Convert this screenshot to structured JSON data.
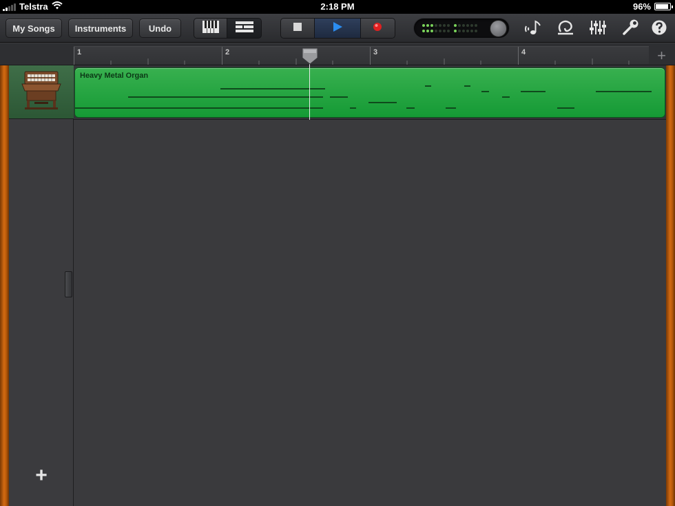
{
  "status_bar": {
    "carrier": "Telstra",
    "time": "2:18 PM",
    "battery": "96%",
    "battery_level": 0.96
  },
  "toolbar": {
    "my_songs_label": "My Songs",
    "instruments_label": "Instruments",
    "undo_label": "Undo",
    "view_toggle": {
      "active": "tracks-view"
    }
  },
  "ruler": {
    "bars": [
      "1",
      "2",
      "3",
      "4"
    ],
    "add_section_label": "+"
  },
  "tracks": [
    {
      "instrument_icon": "organ-icon",
      "region_name": "Heavy Metal Organ",
      "region_color": "#22a33f"
    }
  ],
  "add_track_label": "+",
  "colors": {
    "region": "#22a33f",
    "play_button": "#2b8df0",
    "record_button": "#e02020",
    "wood": "#c6600e",
    "meter_led": "#7ad35a"
  }
}
